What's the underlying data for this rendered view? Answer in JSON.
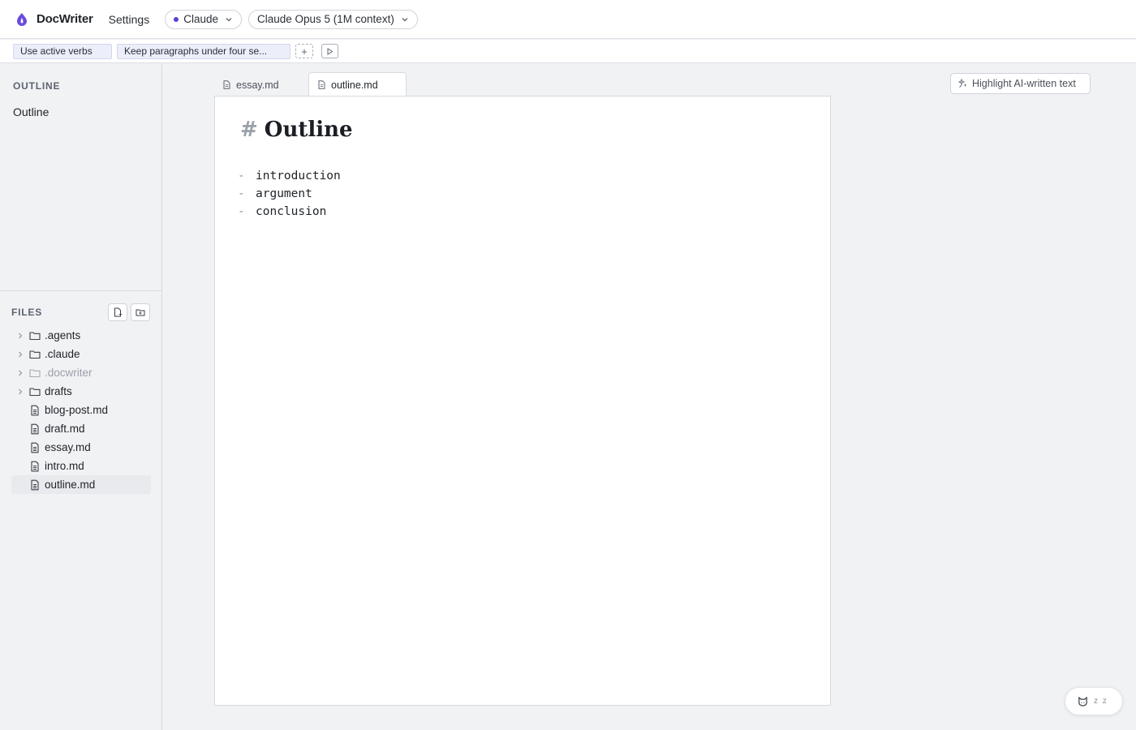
{
  "app": {
    "title": "DocWriter",
    "settings_label": "Settings"
  },
  "provider": {
    "label": "Claude",
    "dot_color": "#5b3fd6"
  },
  "model": {
    "label": "Claude Opus 5 (1M context)"
  },
  "rules": {
    "chips": [
      "Use active verbs",
      "Keep paragraphs under four se..."
    ],
    "add_label": "+"
  },
  "sidebar": {
    "outline_title": "OUTLINE",
    "outline_items": [
      "Outline"
    ],
    "files_title": "FILES",
    "tree": [
      {
        "name": ".agents",
        "type": "folder"
      },
      {
        "name": ".claude",
        "type": "folder"
      },
      {
        "name": ".docwriter",
        "type": "folder",
        "dim": true
      },
      {
        "name": "drafts",
        "type": "folder"
      },
      {
        "name": "blog-post.md",
        "type": "file"
      },
      {
        "name": "draft.md",
        "type": "file"
      },
      {
        "name": "essay.md",
        "type": "file"
      },
      {
        "name": "intro.md",
        "type": "file"
      },
      {
        "name": "outline.md",
        "type": "file",
        "active": true
      }
    ]
  },
  "tabs": [
    {
      "label": "essay.md",
      "active": false
    },
    {
      "label": "outline.md",
      "active": true
    }
  ],
  "toolbar": {
    "highlight_label": "Highlight AI-written text"
  },
  "document": {
    "heading_marker": "#",
    "heading": "Outline",
    "list_marker": "-",
    "items": [
      "introduction",
      "argument",
      "conclusion"
    ]
  },
  "status": {
    "text": "z z"
  }
}
